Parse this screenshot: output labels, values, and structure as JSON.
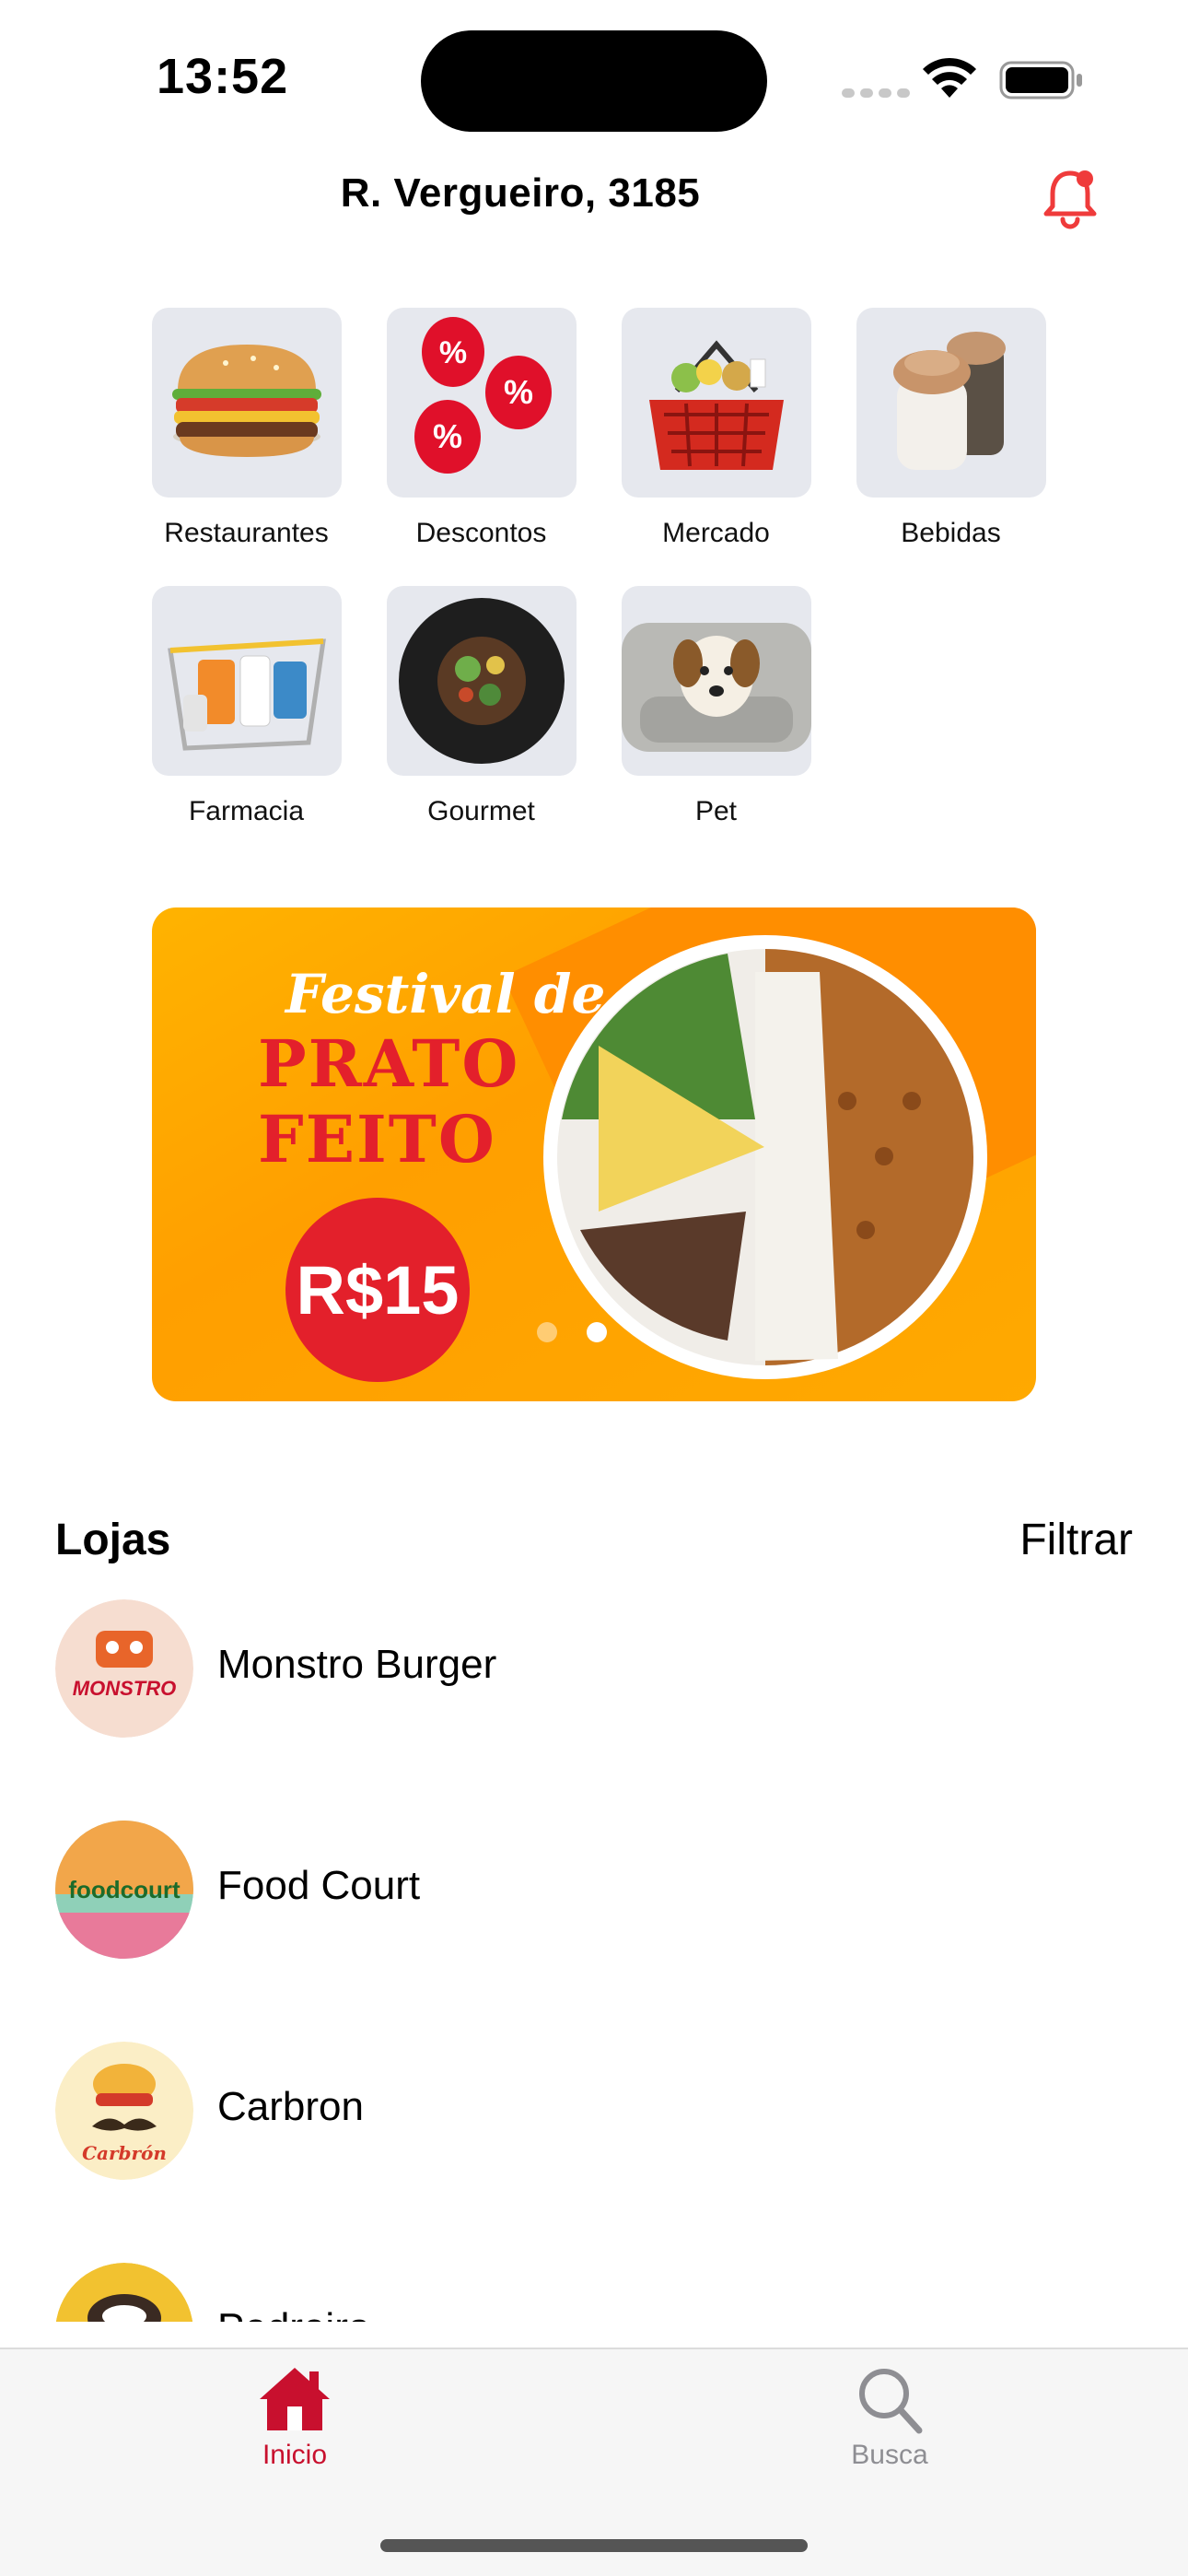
{
  "status_bar": {
    "time": "13:52"
  },
  "header": {
    "address": "R. Vergueiro, 3185",
    "notification_icon": "bell-icon",
    "accent": "#ef3b3b"
  },
  "categories": [
    {
      "label": "Restaurantes",
      "icon": "burger"
    },
    {
      "label": "Descontos",
      "icon": "discount-balloons"
    },
    {
      "label": "Mercado",
      "icon": "basket"
    },
    {
      "label": "Bebidas",
      "icon": "drinks"
    },
    {
      "label": "Farmacia",
      "icon": "pharmacy-basket"
    },
    {
      "label": "Gourmet",
      "icon": "gourmet-plate"
    },
    {
      "label": "Pet",
      "icon": "dog"
    }
  ],
  "banner": {
    "line1": "Festival de",
    "line2": "PRATO",
    "line3": "FEITO",
    "price": "R$15",
    "page_count": 2,
    "active_page": 2
  },
  "stores": {
    "title": "Lojas",
    "filter_label": "Filtrar",
    "items": [
      {
        "name": "Monstro Burger",
        "logo_text": "MONSTRO"
      },
      {
        "name": "Food Court",
        "logo_text": "foodcourt"
      },
      {
        "name": "Carbron",
        "logo_text": "Carbrón"
      },
      {
        "name": "Pedreira",
        "logo_text": ""
      }
    ]
  },
  "tab_bar": {
    "tabs": [
      {
        "label": "Inicio",
        "icon": "home-icon",
        "active": true
      },
      {
        "label": "Busca",
        "icon": "search-icon",
        "active": false
      }
    ],
    "active_color": "#c8102e"
  }
}
